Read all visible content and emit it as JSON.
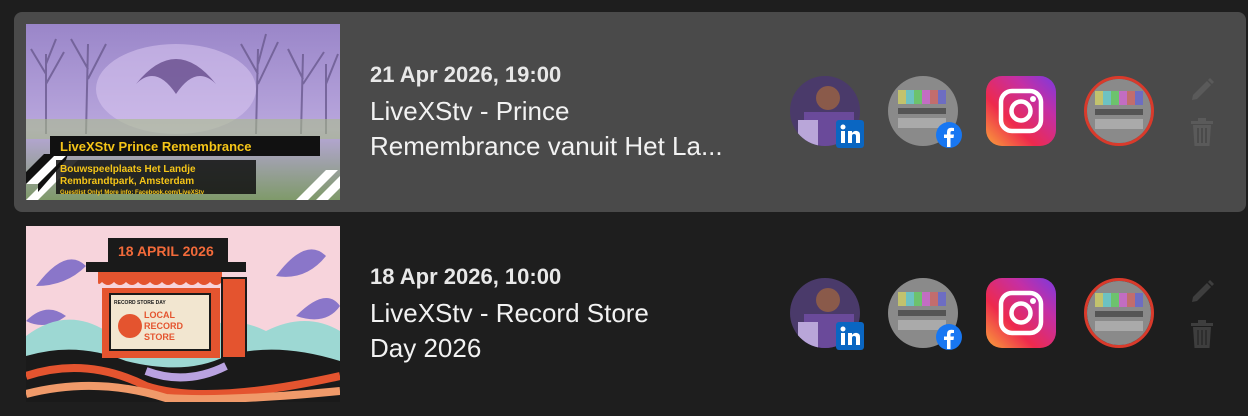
{
  "posts": [
    {
      "date": "21 Apr 2026, 19:00",
      "title_line1": "LiveXStv - Prince",
      "title_line2": "Remembrance vanuit Het La...",
      "thumb": {
        "banner": "LiveXStv Prince Remembrance",
        "line1": "Bouwspeelplaats Het Landje",
        "line2": "Rembrandtpark, Amsterdam",
        "line3": "Guestlist Only! More info: Facebook.com/LiveXStv"
      },
      "channels": [
        "linkedin-profile",
        "facebook-page",
        "instagram",
        "youtube-channel"
      ],
      "selected": true
    },
    {
      "date": "18 Apr 2026, 10:00",
      "title_line1": "LiveXStv - Record Store",
      "title_line2": "Day 2026",
      "thumb": {
        "banner": "18 APRIL 2026",
        "shop_top": "RECORD STORE DAY",
        "shop_line1": "LOCAL",
        "shop_line2": "RECORD",
        "shop_line3": "STORE"
      },
      "channels": [
        "linkedin-profile",
        "facebook-page",
        "instagram",
        "youtube-channel"
      ],
      "selected": false
    }
  ],
  "colors": {
    "background": "#1e1e1e",
    "selected_row": "#4a4a4a",
    "linkedin": "#0a66c2",
    "facebook": "#1877f2",
    "youtube_ring": "#d93a2b",
    "action_icon": "#5a5a5a"
  }
}
